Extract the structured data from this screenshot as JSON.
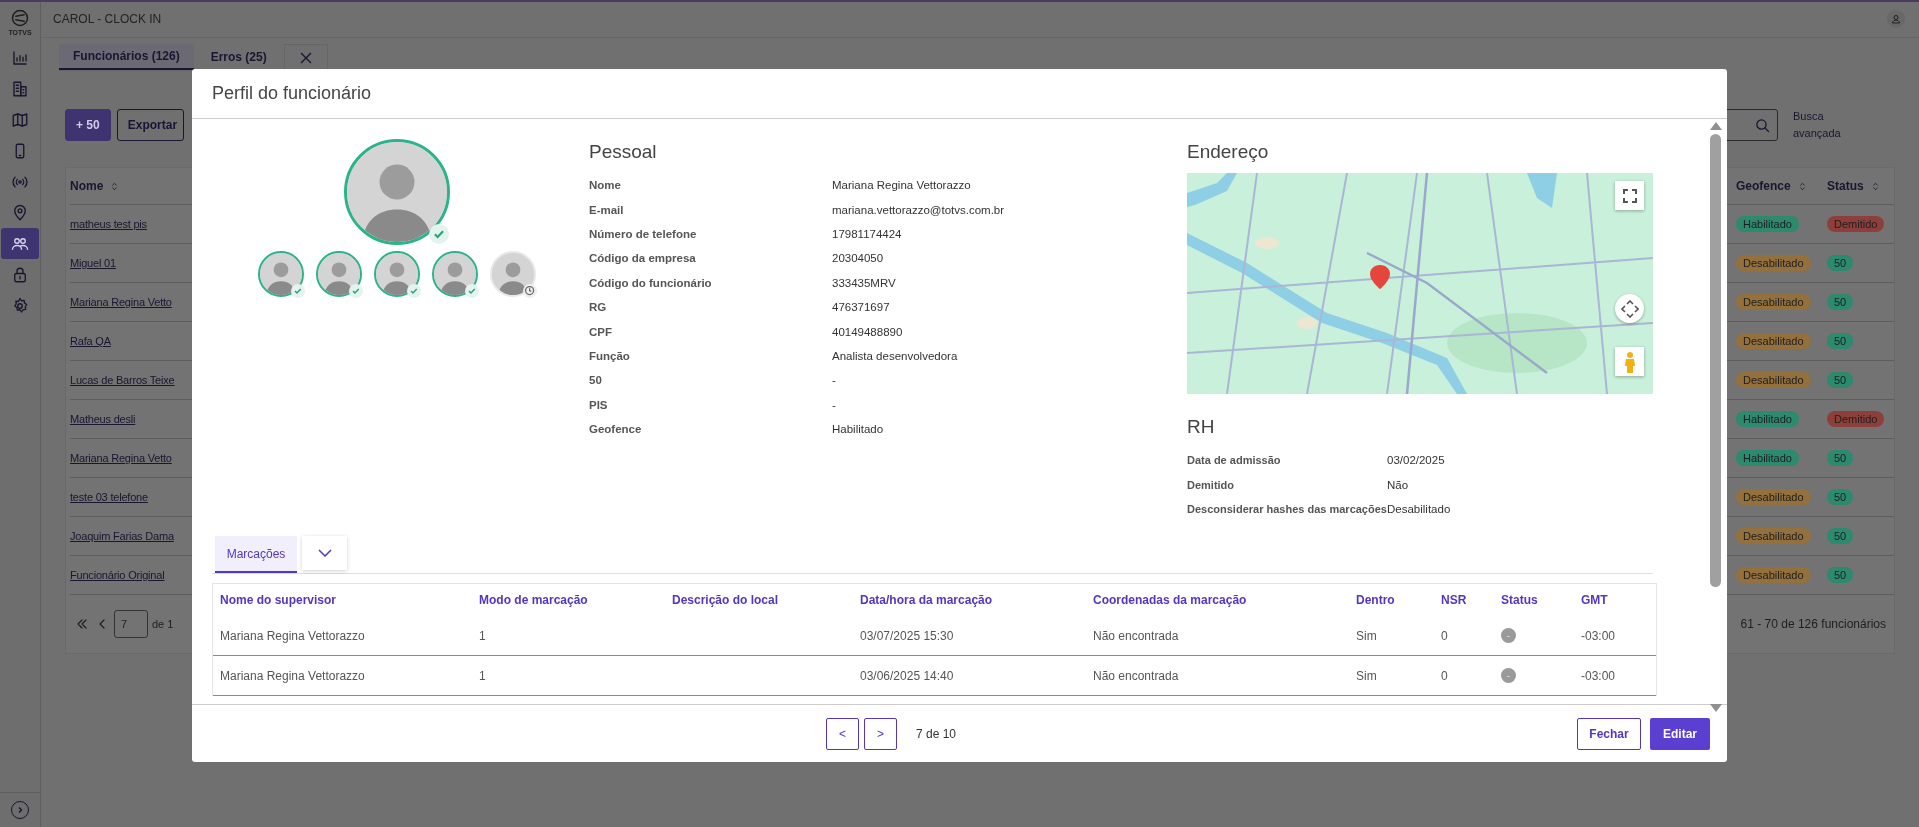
{
  "app": {
    "logo": "TOTVS",
    "title": "CAROL - CLOCK IN"
  },
  "sidebar": {
    "items": [
      {
        "kind": "chart",
        "selected": false
      },
      {
        "kind": "building",
        "selected": false
      },
      {
        "kind": "map",
        "selected": false
      },
      {
        "kind": "phone",
        "selected": false
      },
      {
        "kind": "signal",
        "selected": false
      },
      {
        "kind": "pin",
        "selected": false
      },
      {
        "kind": "users",
        "selected": true
      },
      {
        "kind": "lock",
        "selected": false
      },
      {
        "kind": "gear",
        "selected": false
      }
    ]
  },
  "tabs": [
    {
      "label": "Funcionários (126)",
      "selected": true
    },
    {
      "label": "Erros (25)",
      "selected": false
    }
  ],
  "toolbar": {
    "buttons": [
      {
        "label": "+ 50",
        "kind": "primary"
      },
      {
        "label": "Exportar",
        "kind": "outline"
      }
    ],
    "advanced_search": "Busca avançada"
  },
  "employees": {
    "columns": [
      "Nome",
      "Geofence",
      "Status"
    ],
    "rows": [
      {
        "name": "matheus test pis",
        "geofence": {
          "label": "Habilitado",
          "color": "#2c8a6f"
        },
        "status": {
          "label": "Demitido",
          "color": "#8e3f3b"
        }
      },
      {
        "name": "Miguel 01",
        "geofence": {
          "label": "Desabilitado",
          "color": "#94703d"
        },
        "status": {
          "label": "50",
          "color": "#2c8a6f"
        }
      },
      {
        "name": "Mariana Regina Vetto",
        "geofence": {
          "label": "Desabilitado",
          "color": "#94703d"
        },
        "status": {
          "label": "50",
          "color": "#2c8a6f"
        }
      },
      {
        "name": "Rafa QA",
        "geofence": {
          "label": "Desabilitado",
          "color": "#94703d"
        },
        "status": {
          "label": "50",
          "color": "#2c8a6f"
        }
      },
      {
        "name": "Lucas de Barros Teixe",
        "geofence": {
          "label": "Desabilitado",
          "color": "#94703d"
        },
        "status": {
          "label": "50",
          "color": "#2c8a6f"
        }
      },
      {
        "name": "Matheus desli",
        "geofence": {
          "label": "Habilitado",
          "color": "#2c8a6f"
        },
        "status": {
          "label": "Demitido",
          "color": "#8e3f3b"
        }
      },
      {
        "name": "Mariana Regina Vetto",
        "geofence": {
          "label": "Habilitado",
          "color": "#2c8a6f"
        },
        "status": {
          "label": "50",
          "color": "#2c8a6f"
        }
      },
      {
        "name": "teste 03 telefone",
        "geofence": {
          "label": "Desabilitado",
          "color": "#94703d"
        },
        "status": {
          "label": "50",
          "color": "#2c8a6f"
        }
      },
      {
        "name": "Joaquim Farias Dama",
        "geofence": {
          "label": "Desabilitado",
          "color": "#94703d"
        },
        "status": {
          "label": "50",
          "color": "#2c8a6f"
        }
      },
      {
        "name": "Funcionário Original",
        "geofence": {
          "label": "Desabilitado",
          "color": "#94703d"
        },
        "status": {
          "label": "50",
          "color": "#2c8a6f"
        }
      }
    ]
  },
  "pagination": {
    "page": "7",
    "total": "de 1",
    "summary": "61 - 70 de 126 funcionários"
  },
  "modal": {
    "title": "Perfil do funcionário",
    "photo": {
      "verified": true
    },
    "photos": [
      {
        "verified": true
      },
      {
        "verified": true
      },
      {
        "verified": true
      },
      {
        "verified": true
      },
      {
        "verified": false
      }
    ],
    "personal": {
      "title": "Pessoal",
      "fields": [
        {
          "label": "Nome",
          "value": "Mariana Regina Vettorazzo"
        },
        {
          "label": "E-mail",
          "value": "mariana.vettorazzo@totvs.com.br"
        },
        {
          "label": "Número de telefone",
          "value": "17981174424"
        },
        {
          "label": "Código da empresa",
          "value": "20304050"
        },
        {
          "label": "Código do funcionário",
          "value": "333435MRV"
        },
        {
          "label": "RG",
          "value": "476371697"
        },
        {
          "label": "CPF",
          "value": "40149488890"
        },
        {
          "label": "Função",
          "value": "Analista desenvolvedora"
        },
        {
          "label": "50",
          "value": "-"
        },
        {
          "label": "PIS",
          "value": "-"
        },
        {
          "label": "Geofence",
          "value": "Habilitado"
        }
      ]
    },
    "address": {
      "title": "Endereço"
    },
    "hr": {
      "title": "RH",
      "fields": [
        {
          "label": "Data de admissão",
          "value": "03/02/2025"
        },
        {
          "label": "Demitido",
          "value": "Não"
        },
        {
          "label": "Desconsiderar hashes das marcações",
          "value": "Desabilitado"
        }
      ]
    },
    "tabs": [
      {
        "label": "Marcações",
        "selected": true
      }
    ],
    "table": {
      "columns": [
        "Nome do supervisor",
        "Modo de marcação",
        "Descrição do local",
        "Data/hora da marcação",
        "Coordenadas da marcação",
        "Dentro",
        "NSR",
        "Status",
        "GMT"
      ],
      "rows": [
        {
          "supervisor": "Mariana Regina Vettorazzo",
          "mode": "1",
          "datetime": "03/07/2025 15:30",
          "coordinates": "Não encontrada",
          "inside": "Sim",
          "nsr": "0",
          "status": "-",
          "gmt": "-03:00"
        },
        {
          "supervisor": "Mariana Regina Vettorazzo",
          "mode": "1",
          "datetime": "03/06/2025 14:40",
          "coordinates": "Não encontrada",
          "inside": "Sim",
          "nsr": "0",
          "status": "-",
          "gmt": "-03:00"
        }
      ]
    },
    "footer": {
      "prev": "<",
      "next": ">",
      "page": "7 de 10",
      "close": "Fechar",
      "edit": "Editar"
    }
  }
}
